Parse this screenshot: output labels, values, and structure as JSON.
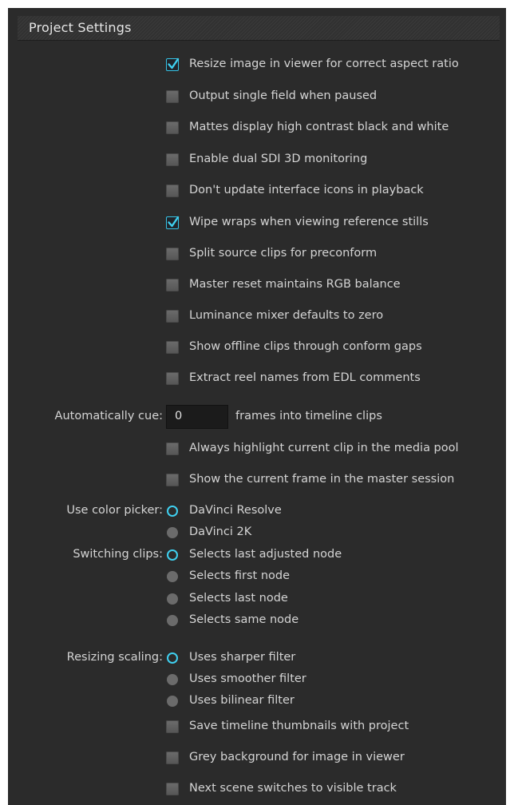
{
  "panel": {
    "title": "Project Settings"
  },
  "checkboxes_top": [
    {
      "label": "Resize image in viewer for correct aspect ratio",
      "checked": true
    },
    {
      "label": "Output single field when paused",
      "checked": false
    },
    {
      "label": "Mattes display high contrast black and white",
      "checked": false
    },
    {
      "label": "Enable dual SDI 3D monitoring",
      "checked": false
    },
    {
      "label": "Don't update interface icons in playback",
      "checked": false
    },
    {
      "label": "Wipe wraps when viewing reference stills",
      "checked": true
    },
    {
      "label": "Split source clips for preconform",
      "checked": false
    },
    {
      "label": "Master reset maintains RGB balance",
      "checked": false
    },
    {
      "label": "Luminance mixer defaults to zero",
      "checked": false
    },
    {
      "label": "Show offline clips through conform gaps",
      "checked": false
    },
    {
      "label": "Extract reel names from EDL comments",
      "checked": false
    }
  ],
  "auto_cue": {
    "label": "Automatically cue:",
    "value": "0",
    "suffix": "frames into timeline clips"
  },
  "checkboxes_mid": [
    {
      "label": "Always highlight current clip in the media pool",
      "checked": false
    },
    {
      "label": "Show the current frame in the master session",
      "checked": false
    }
  ],
  "color_picker": {
    "label": "Use color picker:",
    "options": [
      "DaVinci Resolve",
      "DaVinci 2K"
    ],
    "selected": "DaVinci Resolve"
  },
  "switching_clips": {
    "label": "Switching clips:",
    "options": [
      "Selects last adjusted node",
      "Selects first node",
      "Selects last node",
      "Selects same node"
    ],
    "selected": "Selects last adjusted node"
  },
  "resizing_scaling": {
    "label": "Resizing scaling:",
    "options": [
      "Uses sharper filter",
      "Uses smoother filter",
      "Uses bilinear filter"
    ],
    "selected": "Uses sharper filter"
  },
  "checkboxes_bottom": [
    {
      "label": "Save timeline thumbnails with project",
      "checked": false
    },
    {
      "label": "Grey background for image in viewer",
      "checked": false
    },
    {
      "label": "Next scene switches to visible track",
      "checked": false
    }
  ],
  "colors": {
    "accent": "#3fd0f0",
    "panel_bg": "#2b2b2b",
    "text": "#d4d4d4"
  }
}
